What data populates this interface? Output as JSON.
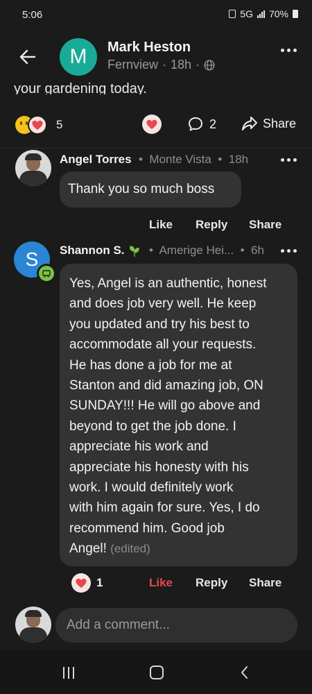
{
  "status": {
    "time": "5:06",
    "network": "5G",
    "battery": "70%"
  },
  "header": {
    "name": "Mark Heston",
    "avatar_letter": "M",
    "location": "Fernview",
    "time": "18h",
    "separator": "·"
  },
  "post": {
    "text_tail": "your gardening today."
  },
  "reactions": {
    "count": "5",
    "comments_count": "2",
    "share_label": "Share"
  },
  "comments": [
    {
      "author": "Angel Torres",
      "location": "Monte Vista",
      "time": "18h",
      "text": "Thank you so much boss",
      "actions": {
        "like": "Like",
        "reply": "Reply",
        "share": "Share"
      }
    },
    {
      "author": "Shannon S.",
      "avatar_letter": "S",
      "location": "Amerige Hei...",
      "time": "6h",
      "text_lines": [
        "Yes, Angel is an authentic, honest",
        "and does job very well.  He keep",
        "you updated and try his best to",
        "accommodate all your requests.",
        "He has done a job for me at",
        "Stanton and did amazing job, ON",
        "SUNDAY!!!  He will go above and",
        "beyond to get the job done.  I",
        "appreciate his work and",
        "appreciate his honesty with his",
        "work.  I would definitely work",
        "with him again for sure.  Yes, I do",
        "recommend him.  Good job"
      ],
      "text_last": "Angel!",
      "edited": "(edited)",
      "reaction_count": "1",
      "actions": {
        "like": "Like",
        "reply": "Reply",
        "share": "Share"
      }
    }
  ],
  "composer": {
    "placeholder": "Add a comment..."
  },
  "colors": {
    "background": "#1b1b1b",
    "bubble": "#333333",
    "like_active": "#e5484d",
    "heart": "#e5484d",
    "teal_avatar": "#1aaa98",
    "blue_avatar": "#2a86d4",
    "badge_green": "#7cc242"
  },
  "icons": [
    "back-arrow-icon",
    "globe-icon",
    "more-icon",
    "laugh-emoji-icon",
    "heart-icon",
    "comment-icon",
    "share-icon",
    "leaf-icon",
    "neighbor-badge-icon",
    "nav-recents-icon",
    "nav-home-icon",
    "nav-back-icon"
  ]
}
